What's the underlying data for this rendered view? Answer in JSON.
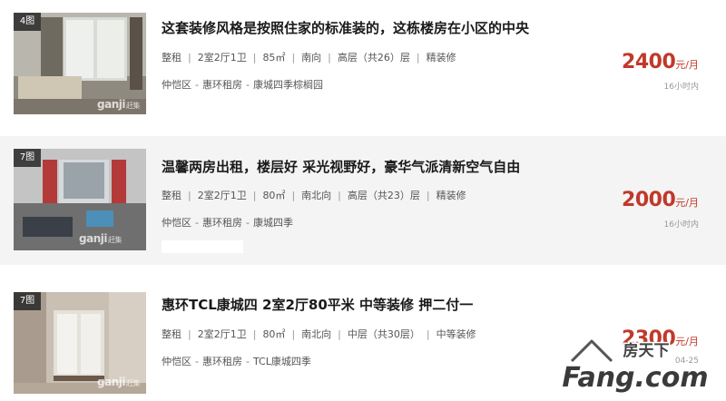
{
  "listings": [
    {
      "photo_count": "4图",
      "title": "这套装修风格是按照住家的标准装的，这栋楼房在小区的中央",
      "specs": [
        "整租",
        "2室2厅1卫",
        "85㎡",
        "南向",
        "高层（共26）层",
        "精装修"
      ],
      "location": [
        "仲恺区",
        "惠环租房",
        "康城四季棕榈园"
      ],
      "price": "2400",
      "price_unit": "元/月",
      "time": "16小时内"
    },
    {
      "photo_count": "7图",
      "title": "温馨两房出租，楼层好 采光视野好，豪华气派清新空气自由",
      "specs": [
        "整租",
        "2室2厅1卫",
        "80㎡",
        "南北向",
        "高层（共23）层",
        "精装修"
      ],
      "location": [
        "仲恺区",
        "惠环租房",
        "康城四季"
      ],
      "price": "2000",
      "price_unit": "元/月",
      "time": "16小时内"
    },
    {
      "photo_count": "7图",
      "title": "惠环TCL康城四 2室2厅80平米 中等装修 押二付一",
      "specs": [
        "整租",
        "2室2厅1卫",
        "80㎡",
        "南北向",
        "中层（共30层）",
        "中等装修"
      ],
      "location": [
        "仲恺区",
        "惠环租房",
        "TCL康城四季"
      ],
      "price": "2300",
      "price_unit": "元/月",
      "time": "04-25"
    }
  ],
  "watermark": {
    "photo_brand": "ganji",
    "photo_brand_cn": "赶集",
    "site_cn": "房天下",
    "site_en": "Fang.com"
  },
  "colors": {
    "price": "#c0392b",
    "alt_row_bg": "#f4f4f4"
  }
}
